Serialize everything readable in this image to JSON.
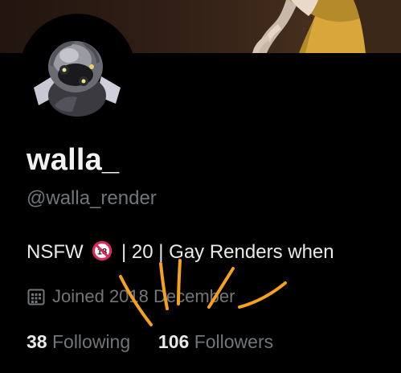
{
  "profile": {
    "display_name": "walla_",
    "handle": "@walla_render",
    "bio_before_icon": "NSFW ",
    "bio_after_icon": " | 20 | Gay Renders when",
    "bio_icon": "no-under-18-icon",
    "joined": "Joined 2018 December",
    "following_count": "38",
    "following_label": "Following",
    "followers_count": "106",
    "followers_label": "Followers"
  },
  "icons": {
    "joined_icon": "calendar-icon",
    "avatar": "robot-avatar"
  },
  "colors": {
    "background": "#000000",
    "primary_text": "#e7e9ea",
    "secondary_text": "#71767b",
    "annotation": "#f5a11c"
  }
}
